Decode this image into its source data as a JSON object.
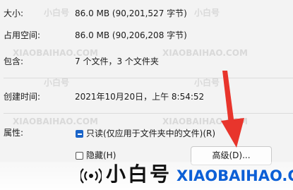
{
  "properties": [
    {
      "label": "大小:",
      "value": "86.0 MB (90,201,527 字节)"
    },
    {
      "label": "占用空间:",
      "value": "86.0 MB (90,206,208 字节)"
    },
    {
      "label": "包含:",
      "value": "7 个文件，3 个文件夹"
    },
    {
      "label": "创建时间:",
      "value": "2021年10月20日，上午 8:54:52"
    }
  ],
  "attributes": {
    "label": "属性:",
    "readonly": {
      "label": "只读(仅应用于文件夹中的文件)(R)",
      "checked": true
    },
    "hidden": {
      "label": "隐藏(H)",
      "checked": false
    },
    "advanced_button": "高级(D)..."
  },
  "watermark": {
    "brand_cn": "小白号",
    "brand_en": "XIAOBAIHAO.COM",
    "small_en": "XIAOBAIHAO.COM",
    "small_cn": "小白号"
  },
  "colors": {
    "accent": "#1a64c8",
    "arrow": "#e8352c",
    "watermark_blue": "#0c5fd6"
  },
  "icons": {
    "banner": "sound-wave-icon",
    "annotation": "red-arrow-icon"
  }
}
